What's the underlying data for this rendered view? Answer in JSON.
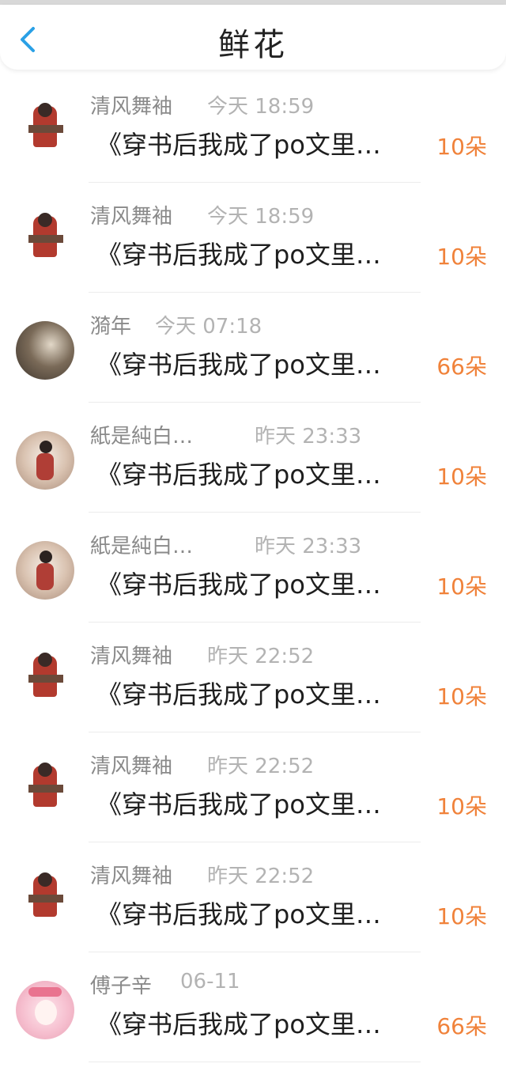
{
  "header": {
    "title": "鲜花",
    "back_icon": "chevron-left-icon",
    "accent": "#2aa0e6"
  },
  "gifts": [
    {
      "user": "清风舞袖",
      "time": "今天 18:59",
      "book": "《穿书后我成了po文里…",
      "amount": "10朵"
    },
    {
      "user": "清风舞袖",
      "time": "今天 18:59",
      "book": "《穿书后我成了po文里…",
      "amount": "10朵"
    },
    {
      "user": "漪年",
      "time": "今天 07:18",
      "book": "《穿书后我成了po文里…",
      "amount": "66朵"
    },
    {
      "user": "紙是純白…",
      "time": "昨天 23:33",
      "book": "《穿书后我成了po文里…",
      "amount": "10朵"
    },
    {
      "user": "紙是純白…",
      "time": "昨天 23:33",
      "book": "《穿书后我成了po文里…",
      "amount": "10朵"
    },
    {
      "user": "清风舞袖",
      "time": "昨天 22:52",
      "book": "《穿书后我成了po文里…",
      "amount": "10朵"
    },
    {
      "user": "清风舞袖",
      "time": "昨天 22:52",
      "book": "《穿书后我成了po文里…",
      "amount": "10朵"
    },
    {
      "user": "清风舞袖",
      "time": "昨天 22:52",
      "book": "《穿书后我成了po文里…",
      "amount": "10朵"
    },
    {
      "user": "傅子辛",
      "time": "06-11",
      "book": "《穿书后我成了po文里…",
      "amount": "66朵"
    }
  ],
  "colors": {
    "amount": "#f0823a",
    "name": "#8a8a8a",
    "time": "#b3b3b3"
  }
}
